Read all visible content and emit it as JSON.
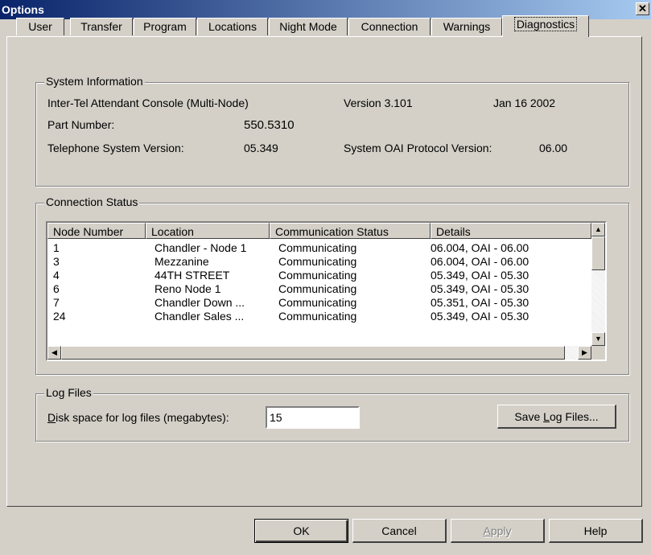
{
  "window": {
    "title": "Options",
    "close_glyph": "✕"
  },
  "tabs": [
    {
      "label": "User"
    },
    {
      "label": "Transfer"
    },
    {
      "label": "Program"
    },
    {
      "label": "Locations"
    },
    {
      "label": "Night Mode"
    },
    {
      "label": "Connection"
    },
    {
      "label": "Warnings"
    },
    {
      "label": "Diagnostics",
      "active": true
    }
  ],
  "system_info": {
    "legend": "System Information",
    "product": "Inter-Tel Attendant Console (Multi-Node)",
    "version": "Version 3.101",
    "date": "Jan 16 2002",
    "part_number_label": "Part Number:",
    "part_number": "550.5310",
    "tel_sys_version_label": "Telephone System Version:",
    "tel_sys_version": "05.349",
    "oai_label": "System OAI Protocol Version:",
    "oai_version": "06.00"
  },
  "connection_status": {
    "legend": "Connection Status",
    "columns": [
      "Node Number",
      "Location",
      "Communication Status",
      "Details"
    ],
    "rows": [
      [
        "1",
        "Chandler - Node 1",
        "Communicating",
        "06.004, OAI - 06.00"
      ],
      [
        "3",
        "Mezzanine",
        "Communicating",
        "06.004, OAI - 06.00"
      ],
      [
        "4",
        "44TH STREET",
        "Communicating",
        "05.349, OAI - 05.30"
      ],
      [
        "6",
        "Reno Node 1",
        "Communicating",
        "05.349, OAI - 05.30"
      ],
      [
        "7",
        "Chandler Down ...",
        "Communicating",
        "05.351, OAI - 05.30"
      ],
      [
        "24",
        "Chandler Sales ...",
        "Communicating",
        "05.349, OAI - 05.30"
      ]
    ]
  },
  "log_files": {
    "legend": "Log Files",
    "disk_label_prefix": "",
    "disk_label_mnemonic": "D",
    "disk_label_rest": "isk space for log files (megabytes):",
    "disk_value": "15",
    "save_prefix": "Save ",
    "save_mnemonic": "L",
    "save_rest": "og Files..."
  },
  "buttons": {
    "ok": "OK",
    "cancel": "Cancel",
    "apply_mnemonic": "A",
    "apply_rest": "pply",
    "help": "Help"
  }
}
